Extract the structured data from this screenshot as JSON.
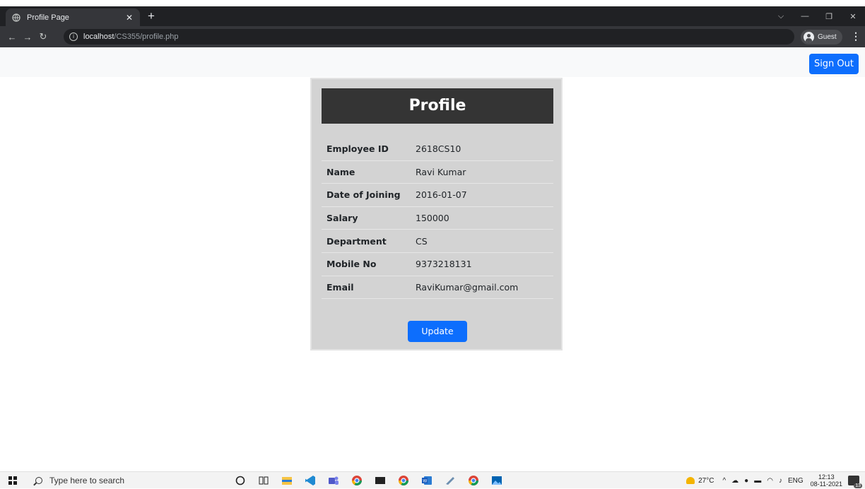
{
  "browser": {
    "tab_title": "Profile Page",
    "url_host": "localhost",
    "url_path": "/CS355/profile.php",
    "profile_label": "Guest"
  },
  "page": {
    "signout_label": "Sign Out",
    "card_title": "Profile",
    "fields": [
      {
        "label": "Employee ID",
        "value": "2618CS10"
      },
      {
        "label": "Name",
        "value": "Ravi Kumar"
      },
      {
        "label": "Date of Joining",
        "value": "2016-01-07"
      },
      {
        "label": "Salary",
        "value": "150000"
      },
      {
        "label": "Department",
        "value": "CS"
      },
      {
        "label": "Mobile No",
        "value": "9373218131"
      },
      {
        "label": "Email",
        "value": "RaviKumar@gmail.com"
      }
    ],
    "update_label": "Update"
  },
  "taskbar": {
    "search_placeholder": "Type here to search",
    "weather": "27°C",
    "language": "ENG",
    "time": "12:13",
    "date": "08-11-2021",
    "notification_count": "13",
    "apps": [
      "cortana-icon",
      "task-view-icon",
      "file-explorer-icon",
      "vscode-icon",
      "teams-icon",
      "chrome-icon",
      "terminal-icon",
      "chrome-icon",
      "word-icon",
      "app-icon",
      "chrome-icon",
      "photos-icon"
    ]
  },
  "colors": {
    "primary": "#0d6efd",
    "card_bg": "#d3d3d3",
    "card_header": "#343434",
    "chrome_dark": "#202124"
  }
}
